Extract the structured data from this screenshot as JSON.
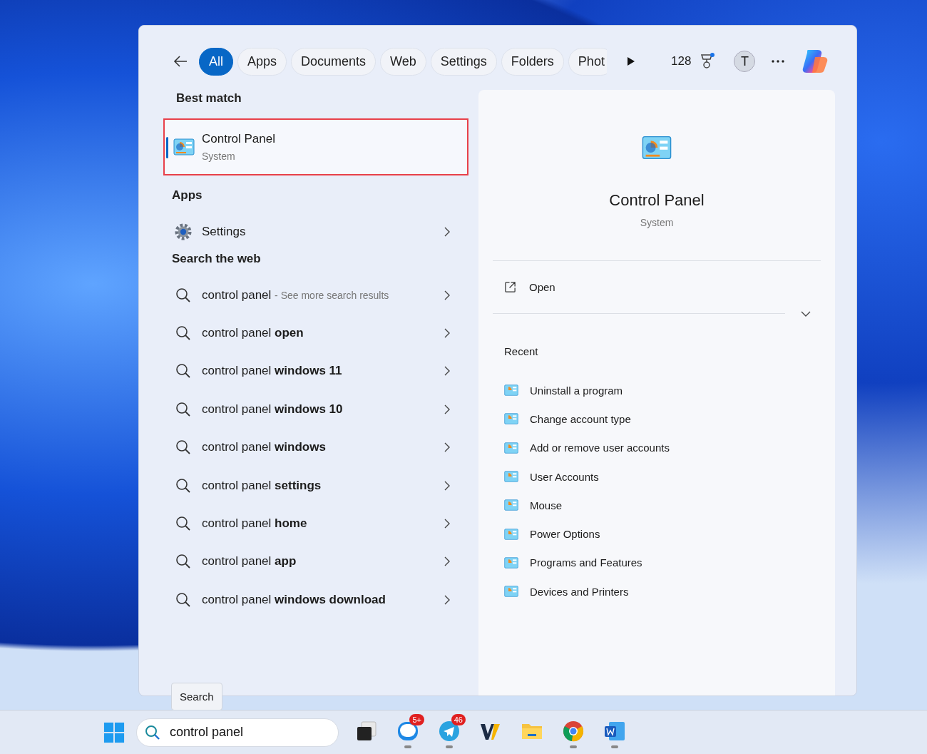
{
  "search_panel": {
    "filters": [
      {
        "label": "All",
        "selected": true
      },
      {
        "label": "Apps",
        "selected": false
      },
      {
        "label": "Documents",
        "selected": false
      },
      {
        "label": "Web",
        "selected": false
      },
      {
        "label": "Settings",
        "selected": false
      },
      {
        "label": "Folders",
        "selected": false
      },
      {
        "label": "Phot",
        "selected": false
      }
    ],
    "points": "128",
    "avatar": "T",
    "best_match": {
      "heading": "Best match",
      "title": "Control Panel",
      "subtitle": "System",
      "selected": true
    },
    "apps": {
      "heading": "Apps",
      "items": [
        {
          "label": "Settings"
        }
      ]
    },
    "web": {
      "heading": "Search the web",
      "items": [
        {
          "kind": "more",
          "text": "control panel",
          "hint": "- See more search results"
        },
        {
          "kind": "suggestion",
          "text": "control panel **open**"
        },
        {
          "kind": "suggestion",
          "text": "control panel **windows 11**"
        },
        {
          "kind": "suggestion",
          "text": "control panel **windows 10**"
        },
        {
          "kind": "suggestion",
          "text": "control panel **windows**"
        },
        {
          "kind": "suggestion",
          "text": "control panel **settings**"
        },
        {
          "kind": "suggestion",
          "text": "control panel **home**"
        },
        {
          "kind": "suggestion",
          "text": "control panel **app**"
        },
        {
          "kind": "suggestion",
          "text": "control panel **windows download**"
        }
      ]
    },
    "details": {
      "title": "Control Panel",
      "subtitle": "System",
      "action": "Open",
      "recent_heading": "Recent",
      "recent": [
        "Uninstall a program",
        "Change account type",
        "Add or remove user accounts",
        "User Accounts",
        "Mouse",
        "Power Options",
        "Programs and Features",
        "Devices and Printers"
      ]
    }
  },
  "tooltip": "Search",
  "taskbar": {
    "search_value": "control panel",
    "apps": [
      {
        "kind": "tasks",
        "running": false
      },
      {
        "kind": "zalo",
        "running": true,
        "badge": "5+"
      },
      {
        "kind": "telegram",
        "running": true,
        "badge": "46"
      },
      {
        "kind": "w",
        "running": false
      },
      {
        "kind": "folder",
        "running": false
      },
      {
        "kind": "chrome",
        "running": true
      },
      {
        "kind": "word",
        "running": true
      }
    ]
  }
}
